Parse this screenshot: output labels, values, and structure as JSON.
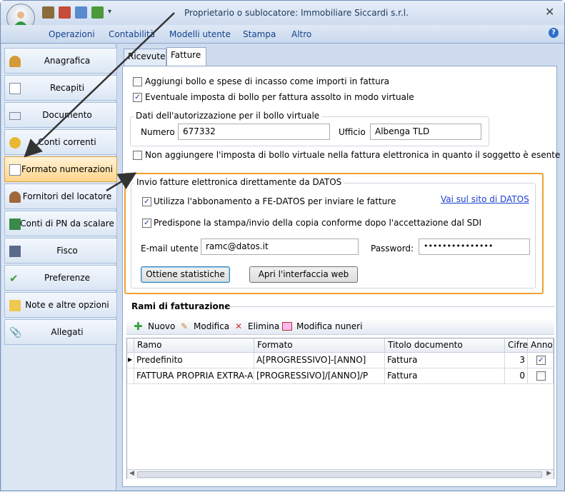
{
  "window": {
    "title": "Proprietario o sublocatore: Immobiliare Siccardi s.r.l.",
    "close": "✕"
  },
  "menu": {
    "items": [
      "Operazioni",
      "Contabilità",
      "Modelli utente",
      "Stampa",
      "Altro"
    ],
    "help": "?"
  },
  "sidebar": {
    "items": [
      {
        "label": "Anagrafica",
        "icon": "person-icon"
      },
      {
        "label": "Recapiti",
        "icon": "page-icon"
      },
      {
        "label": "Documento",
        "icon": "id-card-icon"
      },
      {
        "label": "Conti correnti",
        "icon": "coins-icon"
      },
      {
        "label": "Formato numerazioni",
        "icon": "page-icon"
      },
      {
        "label": "Fornitori del locatore",
        "icon": "person-icon"
      },
      {
        "label": "Conti di PN da scalare",
        "icon": "ledger-icon"
      },
      {
        "label": "Fisco",
        "icon": "calculator-icon"
      },
      {
        "label": "Preferenze",
        "icon": "check-icon"
      },
      {
        "label": "Note e altre opzioni",
        "icon": "notes-icon"
      },
      {
        "label": "Allegati",
        "icon": "paperclip-icon"
      }
    ],
    "active": 4
  },
  "tabs": [
    "Ricevute",
    "Fatture"
  ],
  "options": {
    "bollo_incasso": {
      "label": "Aggiungi bollo e spese di incasso come importi in fattura",
      "checked": false
    },
    "bollo_virtuale": {
      "label": "Eventuale imposta di bollo per fattura assolto in modo virtuale",
      "checked": true
    },
    "no_bollo_fe": {
      "label": "Non aggiungere l'imposta di bollo virtuale nella fattura elettronica in quanto il soggetto è esente",
      "checked": false
    }
  },
  "autorizzazione": {
    "title": "Dati dell'autorizzazione per il bollo virtuale",
    "numero_label": "Numero",
    "numero_value": "677332",
    "ufficio_label": "Ufficio",
    "ufficio_value": "Albenga TLD"
  },
  "datos": {
    "title": "Invio fatture elettronica direttamente da DATOS",
    "abbonamento": {
      "label": "Utilizza l'abbonamento a FE-DATOS per inviare le fatture",
      "checked": true
    },
    "conforme": {
      "label": "Predispone la stampa/invio della copia conforme dopo l'accettazione dal SDI",
      "checked": true
    },
    "link": "Vai sul sito di DATOS",
    "email_label": "E-mail utente",
    "email_value": "ramc@datos.it",
    "password_label": "Password:",
    "password_value": "•••••••••••••••",
    "btn_stats": "Ottiene statistiche",
    "btn_web": "Apri l'interfaccia web"
  },
  "rami": {
    "title": "Rami di fatturazione",
    "toolbar": [
      "Nuovo",
      "Modifica",
      "Elimina",
      "Modifica nuneri"
    ],
    "columns": [
      "Ramo",
      "Formato",
      "Titolo documento",
      "Cifre",
      "Anno"
    ],
    "rows": [
      {
        "ramo": "Predefinito",
        "formato": "A[PROGRESSIVO]-[ANNO]",
        "titolo": "Fattura",
        "cifre": "3",
        "anno": true
      },
      {
        "ramo": "FATTURA PROPRIA EXTRA-A",
        "formato": "[PROGRESSIVO]/[ANNO]/P",
        "titolo": "Fattura",
        "cifre": "0",
        "anno": false
      }
    ]
  },
  "colors": {
    "accent": "#f0a030",
    "link": "#1a3fcf",
    "ribbon": "#15428b"
  }
}
